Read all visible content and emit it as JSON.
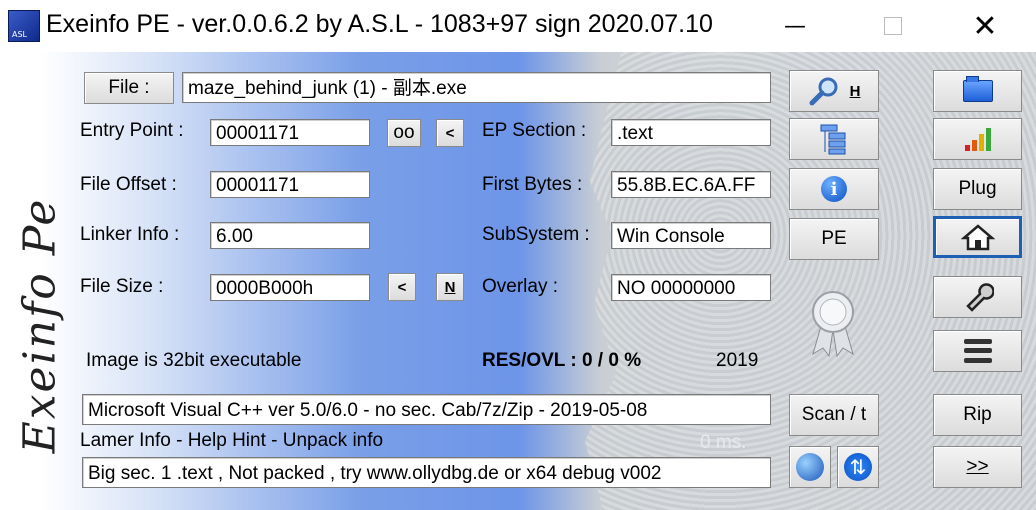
{
  "window": {
    "app_icon_text": "ASL",
    "title": "Exeinfo PE - ver.0.0.6.2  by A.S.L -  1083+97 sign  2020.07.10",
    "minimize": "—",
    "close": "✕"
  },
  "logo_text": "Exeinfo  Pe",
  "file": {
    "button_label": "File :",
    "value": "maze_behind_junk (1) - 副本.exe"
  },
  "fields": {
    "entry_point_label": "Entry Point :",
    "entry_point_value": "00001171",
    "oo_button": "oo",
    "lt_button_1": "<",
    "ep_section_label": "EP Section :",
    "ep_section_value": ".text",
    "file_offset_label": "File Offset :",
    "file_offset_value": "00001171",
    "first_bytes_label": "First Bytes :",
    "first_bytes_value": "55.8B.EC.6A.FF",
    "linker_info_label": "Linker Info :",
    "linker_info_value": "6.00",
    "subsystem_label": "SubSystem :",
    "subsystem_value": "Win Console",
    "file_size_label": "File Size :",
    "file_size_value": "0000B000h",
    "lt_button_2": "<",
    "n_button": "N",
    "overlay_label": "Overlay :",
    "overlay_value": "NO   00000000"
  },
  "status": {
    "image_info": "Image is 32bit executable",
    "res_ovl": "RES/OVL : 0 / 0 %",
    "year": "2019",
    "detection": "Microsoft Visual C++ ver 5.0/6.0 - no sec. Cab/7z/Zip - 2019-05-08",
    "lamer_info": "Lamer Info - Help Hint - Unpack info",
    "timing": "0 ms.",
    "hint": "Big sec. 1 .text , Not packed , try  www.ollydbg.de or x64 debug v002"
  },
  "middle_buttons": {
    "search_hotkey": "H",
    "pe_label": "PE",
    "scan_label": "Scan / t"
  },
  "right_buttons": {
    "plug_label": "Plug",
    "rip_label": "Rip",
    "more_label": ">>"
  },
  "colors": {
    "focus_border": "#1e5fb4",
    "gradient_blue": "#6d95e8"
  }
}
